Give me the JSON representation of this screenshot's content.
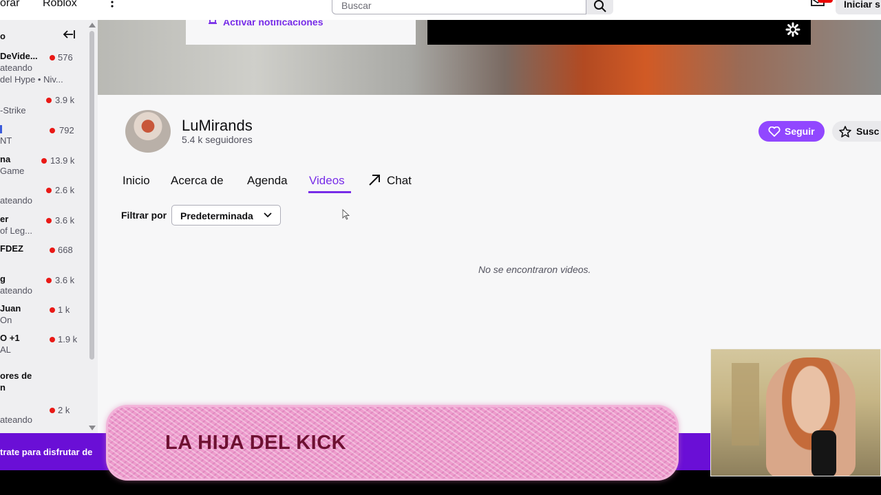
{
  "topnav": {
    "links": [
      "orar",
      "Roblox"
    ],
    "more_icon": "vertical-dots-icon",
    "search_placeholder": "Buscar",
    "search_icon": "search-icon",
    "mail_icon": "inbox-icon",
    "login_label": "Iniciar s"
  },
  "sidebar": {
    "title": "o",
    "collapse_icon": "collapse-arrow-icon",
    "items": [
      {
        "name": "DeVide...",
        "category": "ateando",
        "category2": "del Hype • Niv...",
        "viewers": "576"
      },
      {
        "name": "",
        "category": "-Strike",
        "viewers": "3.9 k"
      },
      {
        "name": "",
        "category": "NT",
        "viewers": "792"
      },
      {
        "name": "na",
        "category": "Game",
        "viewers": "13.9 k"
      },
      {
        "name": "",
        "category": "ateando",
        "viewers": "2.6 k"
      },
      {
        "name": "er",
        "category": "of Leg...",
        "viewers": "3.6 k"
      },
      {
        "name": "FDEZ",
        "category": "",
        "viewers": "668"
      },
      {
        "name": "g",
        "category": "ateando",
        "viewers": "3.6 k"
      },
      {
        "name": "Juan",
        "category": "On",
        "viewers": "1 k"
      },
      {
        "name": "O +1",
        "category": "AL",
        "viewers": "1.9 k"
      },
      {
        "name": "ores de",
        "category": "n",
        "viewers": ""
      },
      {
        "name": "",
        "category": "ateando",
        "viewers": "2 k"
      }
    ]
  },
  "banner": {
    "notif_label": "Activar notificaciones",
    "settings_icon": "gear-icon"
  },
  "channel": {
    "name": "LuMirands",
    "followers": "5.4 k seguidores",
    "follow_label": "Seguir",
    "subscribe_label": "Susc"
  },
  "tabs": [
    {
      "label": "Inicio",
      "active": false
    },
    {
      "label": "Acerca de",
      "active": false
    },
    {
      "label": "Agenda",
      "active": false
    },
    {
      "label": "Videos",
      "active": true
    },
    {
      "label": "Chat",
      "active": false
    }
  ],
  "filter": {
    "label": "Filtrar por",
    "selected": "Predeterminada"
  },
  "empty_message": "No se encontraron videos.",
  "bottom": {
    "text": "trate para disfrutar de"
  },
  "overlay": {
    "text": "LA HIJA DEL KICK"
  },
  "colors": {
    "accent": "#9147ff",
    "accent_text": "#772ce8",
    "live": "#e91916",
    "bottom_bar": "#6a0fd6"
  }
}
